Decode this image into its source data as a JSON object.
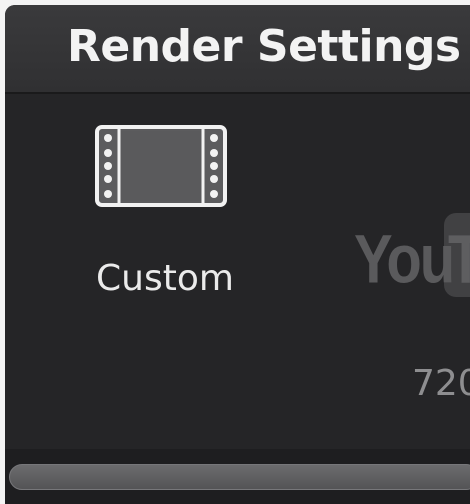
{
  "window": {
    "title": "Render Settings -"
  },
  "presets": [
    {
      "label": "Custom",
      "icon": "film-strip-icon",
      "selected": true
    },
    {
      "label": "720",
      "icon": "youtube-logo-icon",
      "logo_text": "You",
      "logo_box_text": "T",
      "selected": false
    }
  ],
  "colors": {
    "panel_bg": "#252527",
    "titlebar_bg": "#333335",
    "title_text": "#f3f3f3",
    "label_active": "#ebebeb",
    "label_inactive": "#8e8e90"
  }
}
